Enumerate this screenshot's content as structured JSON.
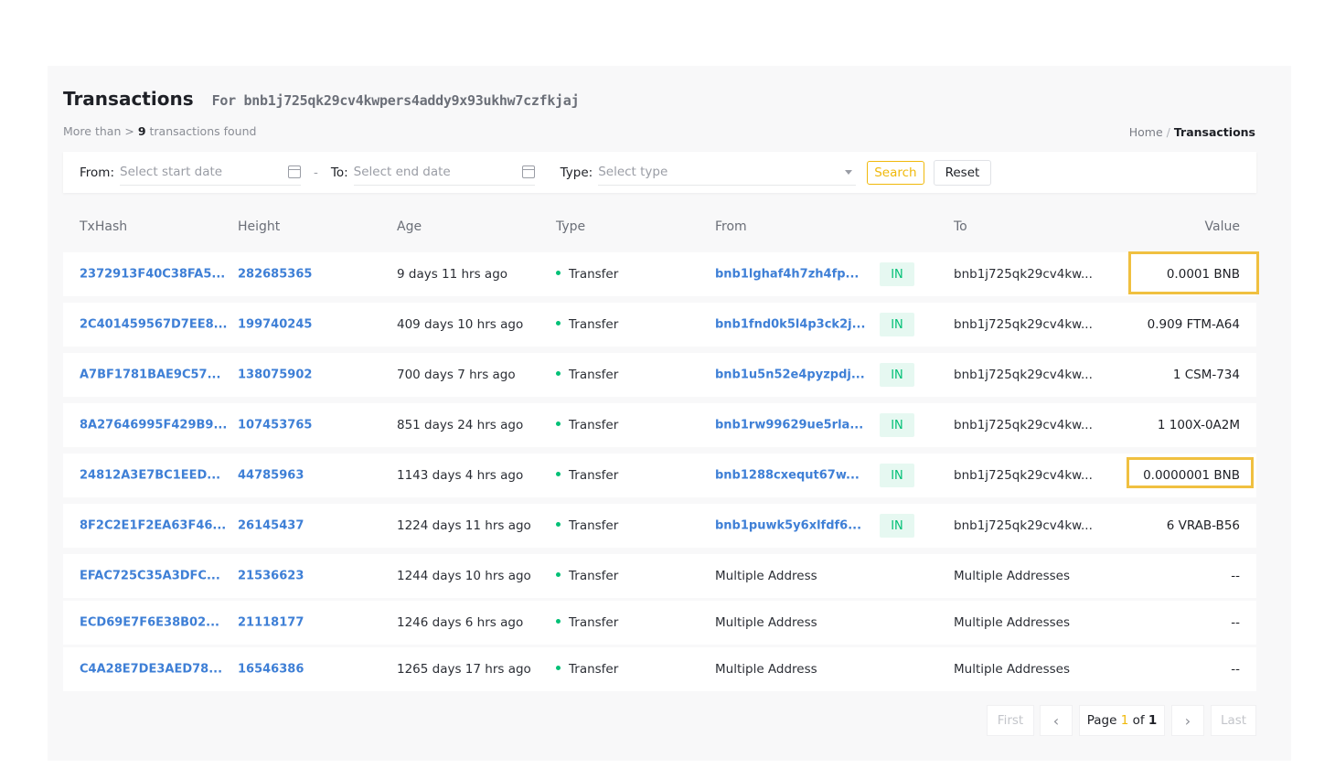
{
  "header": {
    "title": "Transactions",
    "for_prefix": "For",
    "address": "bnb1j725qk29cv4kwpers4addy9x93ukhw7czfkjaj",
    "found_prefix": "More than >",
    "found_count": "9",
    "found_suffix": "transactions found"
  },
  "breadcrumb": {
    "home": "Home",
    "sep": "/",
    "current": "Transactions"
  },
  "filter": {
    "from_label": "From:",
    "from_placeholder": "Select start date",
    "dash": "-",
    "to_label": "To:",
    "to_placeholder": "Select end date",
    "type_label": "Type:",
    "type_placeholder": "Select type",
    "search_label": "Search",
    "reset_label": "Reset"
  },
  "table": {
    "columns": [
      "TxHash",
      "Height",
      "Age",
      "Type",
      "From",
      "To",
      "Value"
    ],
    "rows": [
      {
        "hash": "2372913F40C38FA5...",
        "height": "282685365",
        "age": "9 days 11 hrs ago",
        "type": "Transfer",
        "from": "bnb1lghaf4h7zh4fp...",
        "from_link": true,
        "dir": "IN",
        "to": "bnb1j725qk29cv4kw...",
        "value": "0.0001 BNB",
        "highlight": true
      },
      {
        "hash": "2C401459567D7EE8...",
        "height": "199740245",
        "age": "409 days 10 hrs ago",
        "type": "Transfer",
        "from": "bnb1fnd0k5l4p3ck2j...",
        "from_link": true,
        "dir": "IN",
        "to": "bnb1j725qk29cv4kw...",
        "value": "0.909 FTM-A64",
        "highlight": false
      },
      {
        "hash": "A7BF1781BAE9C57...",
        "height": "138075902",
        "age": "700 days 7 hrs ago",
        "type": "Transfer",
        "from": "bnb1u5n52e4pyzpdj...",
        "from_link": true,
        "dir": "IN",
        "to": "bnb1j725qk29cv4kw...",
        "value": "1 CSM-734",
        "highlight": false
      },
      {
        "hash": "8A27646995F429B9...",
        "height": "107453765",
        "age": "851 days 24 hrs ago",
        "type": "Transfer",
        "from": "bnb1rw99629ue5rla...",
        "from_link": true,
        "dir": "IN",
        "to": "bnb1j725qk29cv4kw...",
        "value": "1 100X-0A2M",
        "highlight": false
      },
      {
        "hash": "24812A3E7BC1EED...",
        "height": "44785963",
        "age": "1143 days 4 hrs ago",
        "type": "Transfer",
        "from": "bnb1288cxequt67w...",
        "from_link": true,
        "dir": "IN",
        "to": "bnb1j725qk29cv4kw...",
        "value": "0.0000001 BNB",
        "highlight": true
      },
      {
        "hash": "8F2C2E1F2EA63F46...",
        "height": "26145437",
        "age": "1224 days 11 hrs ago",
        "type": "Transfer",
        "from": "bnb1puwk5y6xlfdf6...",
        "from_link": true,
        "dir": "IN",
        "to": "bnb1j725qk29cv4kw...",
        "value": "6 VRAB-B56",
        "highlight": false
      },
      {
        "hash": "EFAC725C35A3DFC...",
        "height": "21536623",
        "age": "1244 days 10 hrs ago",
        "type": "Transfer",
        "from": "Multiple Address",
        "from_link": false,
        "dir": "",
        "to": "Multiple Addresses",
        "value": "--",
        "highlight": false
      },
      {
        "hash": "ECD69E7F6E38B02...",
        "height": "21118177",
        "age": "1246 days 6 hrs ago",
        "type": "Transfer",
        "from": "Multiple Address",
        "from_link": false,
        "dir": "",
        "to": "Multiple Addresses",
        "value": "--",
        "highlight": false
      },
      {
        "hash": "C4A28E7DE3AED78...",
        "height": "16546386",
        "age": "1265 days 17 hrs ago",
        "type": "Transfer",
        "from": "Multiple Address",
        "from_link": false,
        "dir": "",
        "to": "Multiple Addresses",
        "value": "--",
        "highlight": false
      }
    ]
  },
  "pager": {
    "first": "First",
    "prev": "‹",
    "page_label": "Page",
    "current": "1",
    "of": "of",
    "total": "1",
    "next": "›",
    "last": "Last"
  },
  "colors": {
    "link": "#3e7fd6",
    "accent": "#f0b90b",
    "in_badge": "#02c076",
    "highlight_box": "#f0c040"
  }
}
